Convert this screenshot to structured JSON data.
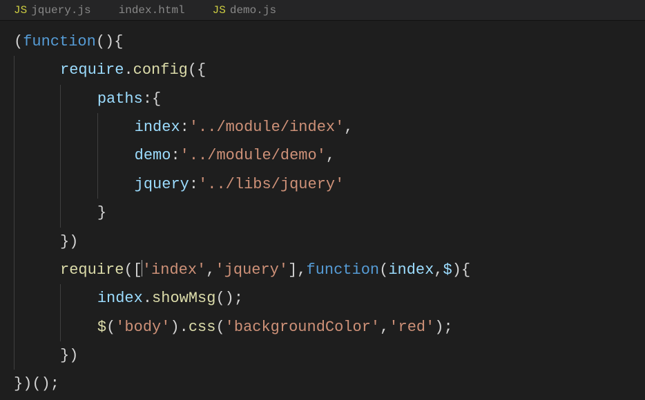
{
  "tabs": [
    {
      "label": "jquery.js"
    },
    {
      "label": "index.html"
    },
    {
      "label": "demo.js"
    }
  ],
  "code": {
    "l1_open": "(",
    "l1_kw": "function",
    "l1_rest": "(){",
    "l2_var": "require",
    "l2_dot": ".",
    "l2_fn": "config",
    "l2_rest": "({",
    "l3_prop": "paths",
    "l3_rest": ":{",
    "l4_prop": "index",
    "l4_colon": ":",
    "l4_str": "'../module/index'",
    "l4_comma": ",",
    "l5_prop": "demo",
    "l5_colon": ":",
    "l5_str": "'../module/demo'",
    "l5_comma": ",",
    "l6_prop": "jquery",
    "l6_colon": ":",
    "l6_str": "'../libs/jquery'",
    "l7_close": "}",
    "l8_close": "})",
    "l9_fn": "require",
    "l9_open": "([",
    "l9_s1": "'index'",
    "l9_c1": ",",
    "l9_s2": "'jquery'",
    "l9_close": "],",
    "l9_kw": "function",
    "l9_paren": "(",
    "l9_a1": "index",
    "l9_ac": ",",
    "l9_a2": "$",
    "l9_end": "){",
    "l10_v": "index",
    "l10_dot": ".",
    "l10_fn": "showMsg",
    "l10_rest": "();",
    "l11_fn": "$",
    "l11_o": "(",
    "l11_s1": "'body'",
    "l11_c1": ").",
    "l11_fn2": "css",
    "l11_o2": "(",
    "l11_s2": "'backgroundColor'",
    "l11_cm": ",",
    "l11_s3": "'red'",
    "l11_end": ");",
    "l12_close": "})",
    "l13_close": "})();"
  }
}
